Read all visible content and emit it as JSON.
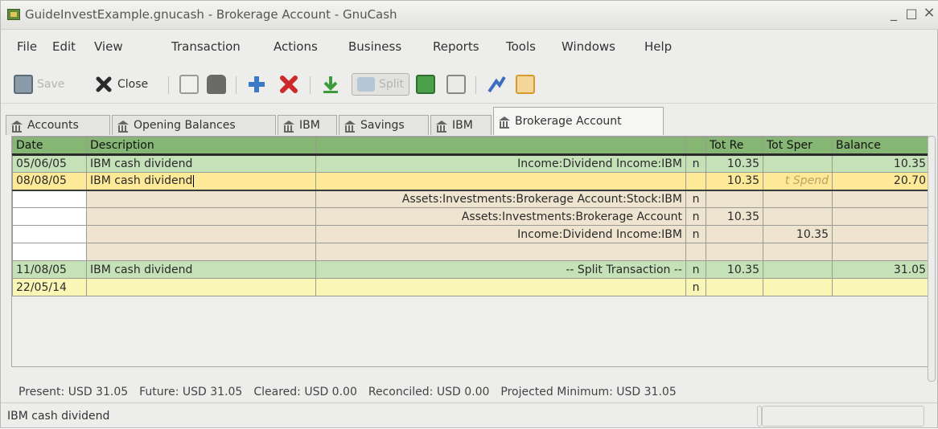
{
  "window": {
    "title": "GuideInvestExample.gnucash - Brokerage Account - GnuCash",
    "minimize": "_",
    "maximize": "□",
    "close": "×"
  },
  "menu": [
    "File",
    "Edit",
    "View",
    "Transaction",
    "Actions",
    "Business",
    "Reports",
    "Tools",
    "Windows",
    "Help"
  ],
  "toolbar": {
    "save": "Save",
    "close": "Close",
    "split": "Split"
  },
  "tabs": [
    "Accounts",
    "Opening Balances",
    "IBM",
    "Savings",
    "IBM",
    "Brokerage Account"
  ],
  "register": {
    "headers": [
      "Date",
      "Description",
      "",
      "",
      "Tot Re",
      "Tot Sper",
      "Balance"
    ],
    "rows": [
      {
        "date": "05/06/05",
        "desc": "IBM cash dividend",
        "transfer": "Income:Dividend Income:IBM",
        "r": "n",
        "rec": "10.35",
        "spend": "",
        "balance": "10.35"
      },
      {
        "date": "08/08/05",
        "desc": "IBM cash dividend",
        "transfer": "",
        "r": "",
        "rec": "10.35",
        "spend": "t Spend",
        "balance": "20.70"
      },
      {
        "date": "",
        "desc": "",
        "transfer": "Assets:Investments:Brokerage Account:Stock:IBM",
        "r": "n",
        "rec": "",
        "spend": "",
        "balance": ""
      },
      {
        "date": "",
        "desc": "",
        "transfer": "Assets:Investments:Brokerage Account",
        "r": "n",
        "rec": "10.35",
        "spend": "",
        "balance": ""
      },
      {
        "date": "",
        "desc": "",
        "transfer": "Income:Dividend Income:IBM",
        "r": "n",
        "rec": "",
        "spend": "10.35",
        "balance": ""
      },
      {
        "date": "",
        "desc": "",
        "transfer": "",
        "r": "",
        "rec": "",
        "spend": "",
        "balance": ""
      },
      {
        "date": "11/08/05",
        "desc": "IBM cash dividend",
        "transfer": "-- Split Transaction --",
        "r": "n",
        "rec": "10.35",
        "spend": "",
        "balance": "31.05"
      },
      {
        "date": "22/05/14",
        "desc": "",
        "transfer": "",
        "r": "n",
        "rec": "",
        "spend": "",
        "balance": ""
      }
    ]
  },
  "summary": {
    "present": "Present: USD 31.05",
    "future": "Future: USD 31.05",
    "cleared": "Cleared: USD 0.00",
    "reconciled": "Reconciled: USD 0.00",
    "projected": "Projected Minimum: USD 31.05"
  },
  "status": "IBM cash dividend",
  "colors": {
    "header": "#86b673",
    "row_green": "#c5e1b8",
    "row_yellow": "#fde998",
    "row_split": "#efe4cf",
    "row_blank": "#faf7b6"
  }
}
